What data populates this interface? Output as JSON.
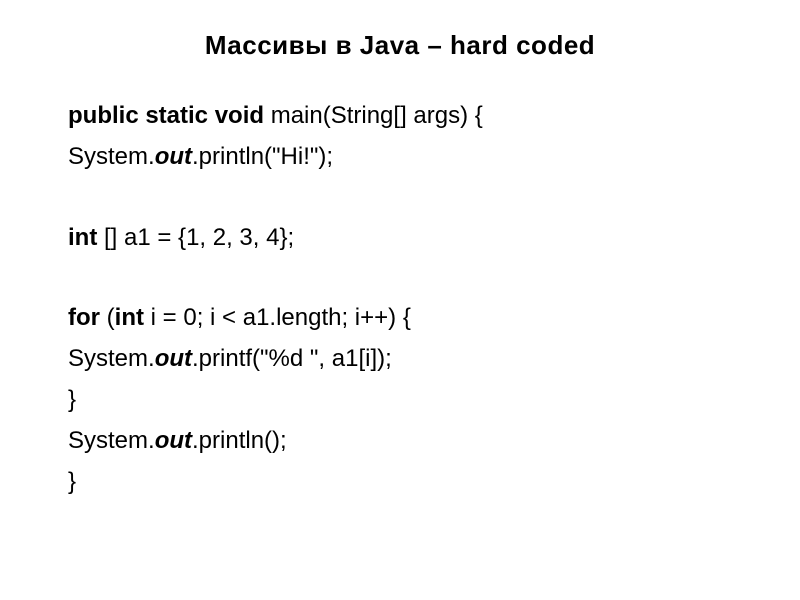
{
  "title": "Массивы в Java – hard coded",
  "code": {
    "line1": {
      "keyword": "public static void",
      "rest": " main(String[] args) {"
    },
    "line2": {
      "prefix": "System.",
      "out": "out",
      "rest": ".println(\"Hi!\");"
    },
    "line3": {
      "keyword": "int",
      "rest": " [] a1 = {1, 2, 3, 4};"
    },
    "line4": {
      "for": "for",
      "paren": " (",
      "int": "int",
      "rest": " i = 0; i < a1.length; i++) {"
    },
    "line5": {
      "prefix": "System.",
      "out": "out",
      "rest": ".printf(\"%d \", a1[i]);"
    },
    "line6": {
      "text": "}"
    },
    "line7": {
      "prefix": "System.",
      "out": "out",
      "rest": ".println();"
    },
    "line8": {
      "text": "}"
    }
  }
}
